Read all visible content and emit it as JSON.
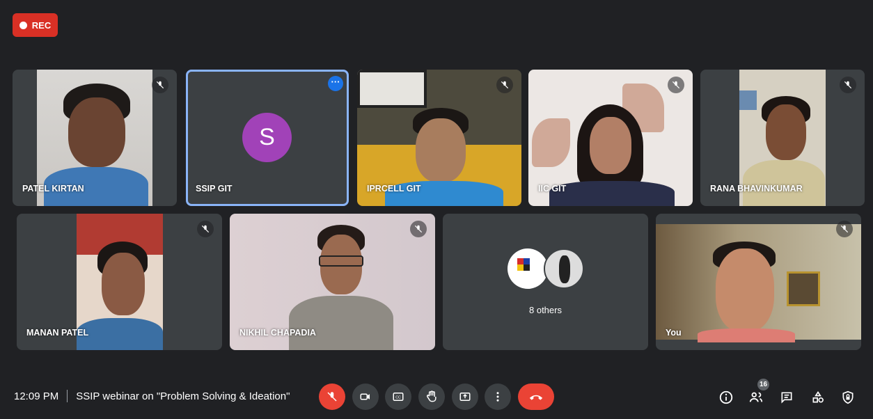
{
  "rec_label": "REC",
  "tiles_row1": [
    {
      "name": "PATEL KIRTAN"
    },
    {
      "name": "SSIP GIT",
      "avatar_letter": "S"
    },
    {
      "name": "IPRCELL GIT"
    },
    {
      "name": "IIC GIT"
    },
    {
      "name": "RANA BHAVINKUMAR"
    }
  ],
  "tiles_row2": [
    {
      "name": "MANAN PATEL"
    },
    {
      "name": "NIKHIL CHAPADIA"
    },
    {
      "name": "8 others"
    },
    {
      "name": "You"
    }
  ],
  "meeting": {
    "time": "12:09 PM",
    "title": "SSIP webinar on \"Problem Solving & Ideation\""
  },
  "participants_count": "16",
  "colors": {
    "accent": "#8ab4f8",
    "danger": "#ea4335",
    "rec": "#d93025",
    "tile": "#3c4043",
    "background": "#202124",
    "avatar_s": "#a142b8"
  }
}
